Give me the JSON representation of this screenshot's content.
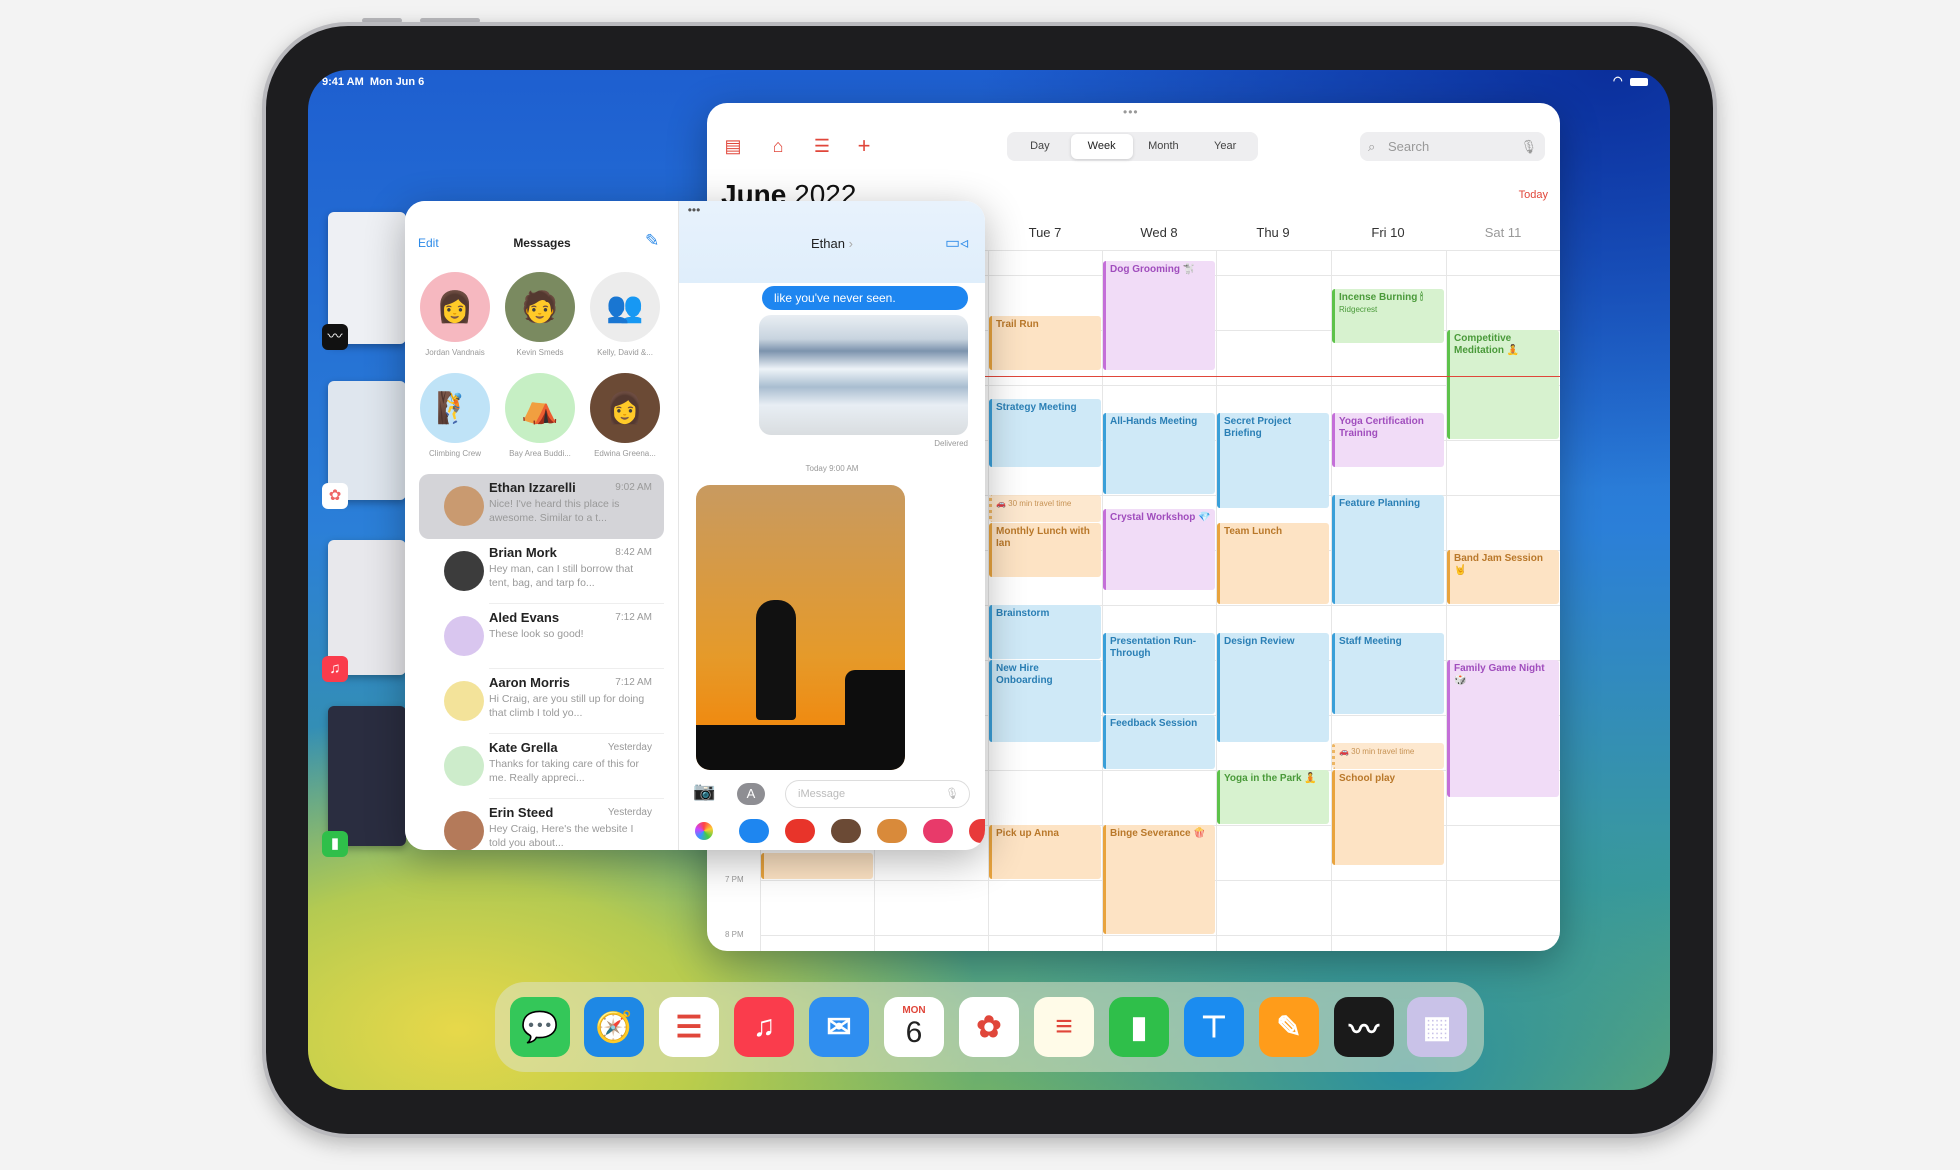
{
  "status_bar": {
    "time": "9:41 AM",
    "date": "Mon Jun 6"
  },
  "calendar": {
    "toolbar_icons": [
      "calendar-icon",
      "inbox-icon",
      "list-icon",
      "plus-icon"
    ],
    "views": [
      "Day",
      "Week",
      "Month",
      "Year"
    ],
    "selected_view": "Week",
    "search_placeholder": "Search",
    "month": "June",
    "year": "2022",
    "today_label": "Today",
    "days": [
      {
        "label": "Tue 7"
      },
      {
        "label": "Wed 8"
      },
      {
        "label": "Thu 9"
      },
      {
        "label": "Fri 10"
      },
      {
        "label": "Sat 11"
      }
    ],
    "time_labels": [
      {
        "label": "7 PM"
      },
      {
        "label": "8 PM"
      }
    ],
    "colors": {
      "blue": "#3a9fd8",
      "purple": "#c46fd8",
      "orange": "#e8a33d",
      "green": "#5dc24a",
      "now_line": "#e0463a"
    },
    "events": [
      {
        "day": "Sun 5",
        "title": "",
        "start": "18:30",
        "end": "19:00",
        "color": "orange"
      },
      {
        "day": "Tue 7",
        "title": "Trail Run",
        "start": "8:45",
        "end": "9:45",
        "color": "orange"
      },
      {
        "day": "Tue 7",
        "title": "Strategy Meeting",
        "start": "10:15",
        "end": "11:30",
        "color": "blue"
      },
      {
        "day": "Tue 7",
        "title": "🚗 30 min travel time",
        "start": "12:00",
        "end": "12:30",
        "color": "orange",
        "travel": true
      },
      {
        "day": "Tue 7",
        "title": "Monthly Lunch with Ian",
        "start": "12:30",
        "end": "13:30",
        "color": "orange"
      },
      {
        "day": "Tue 7",
        "title": "Brainstorm",
        "start": "14:00",
        "end": "15:00",
        "color": "blue"
      },
      {
        "day": "Tue 7",
        "title": "New Hire Onboarding",
        "start": "15:00",
        "end": "16:30",
        "color": "blue"
      },
      {
        "day": "Tue 7",
        "title": "Pick up Anna",
        "start": "18:00",
        "end": "19:00",
        "color": "orange"
      },
      {
        "day": "Wed 8",
        "title": "Dog Grooming 🐩",
        "start": "7:45",
        "end": "9:45",
        "color": "purple"
      },
      {
        "day": "Wed 8",
        "title": "All-Hands Meeting",
        "start": "10:30",
        "end": "12:00",
        "color": "blue"
      },
      {
        "day": "Wed 8",
        "title": "Crystal Workshop 💎",
        "start": "12:15",
        "end": "13:45",
        "color": "purple"
      },
      {
        "day": "Wed 8",
        "title": "Presentation Run-Through",
        "start": "14:30",
        "end": "16:00",
        "color": "blue"
      },
      {
        "day": "Wed 8",
        "title": "Feedback Session",
        "start": "16:00",
        "end": "17:00",
        "color": "blue"
      },
      {
        "day": "Wed 8",
        "title": "Binge Severance 🍿",
        "start": "18:00",
        "end": "20:00",
        "color": "orange"
      },
      {
        "day": "Thu 9",
        "title": "Secret Project Briefing",
        "start": "10:30",
        "end": "12:15",
        "color": "blue"
      },
      {
        "day": "Thu 9",
        "title": "Team Lunch",
        "start": "12:30",
        "end": "14:00",
        "color": "orange"
      },
      {
        "day": "Thu 9",
        "title": "Design Review",
        "start": "14:30",
        "end": "16:30",
        "color": "blue"
      },
      {
        "day": "Thu 9",
        "title": "Yoga in the Park 🧘",
        "start": "17:00",
        "end": "18:00",
        "color": "green"
      },
      {
        "day": "Fri 10",
        "title": "Incense Burning 🕯",
        "location": "Ridgecrest",
        "start": "8:15",
        "end": "9:15",
        "color": "green"
      },
      {
        "day": "Fri 10",
        "title": "Yoga Certification Training",
        "start": "10:30",
        "end": "11:30",
        "color": "purple"
      },
      {
        "day": "Fri 10",
        "title": "Feature Planning",
        "start": "12:00",
        "end": "14:00",
        "color": "blue"
      },
      {
        "day": "Fri 10",
        "title": "Staff Meeting",
        "start": "14:30",
        "end": "16:00",
        "color": "blue"
      },
      {
        "day": "Fri 10",
        "title": "🚗 30 min travel time",
        "start": "16:30",
        "end": "17:00",
        "color": "orange",
        "travel": true
      },
      {
        "day": "Fri 10",
        "title": "School play",
        "start": "17:00",
        "end": "18:45",
        "color": "orange"
      },
      {
        "day": "Sat 11",
        "title": "Competitive Meditation 🧘",
        "start": "9:00",
        "end": "11:00",
        "color": "green"
      },
      {
        "day": "Sat 11",
        "title": "Band Jam Session 🤘",
        "start": "13:00",
        "end": "14:00",
        "color": "orange"
      },
      {
        "day": "Sat 11",
        "title": "Family Game Night 🎲",
        "start": "15:00",
        "end": "17:30",
        "color": "purple"
      }
    ]
  },
  "messages": {
    "edit_label": "Edit",
    "title": "Messages",
    "pinned": [
      {
        "name": "Jordan Vandnais",
        "bg": "#f6b8c0",
        "glyph": "👩"
      },
      {
        "name": "Kevin Smeds",
        "bg": "#7a8a60",
        "glyph": "🧑"
      },
      {
        "name": "Kelly, David &...",
        "bg": "#ececec",
        "glyph": "👥"
      },
      {
        "name": "Climbing Crew",
        "bg": "#bfe3f7",
        "glyph": "🧗"
      },
      {
        "name": "Bay Area Buddi...",
        "bg": "#c6efc4",
        "glyph": "⛺"
      },
      {
        "name": "Edwina Greena...",
        "bg": "#6b4a35",
        "glyph": "👩"
      }
    ],
    "conversations": [
      {
        "name": "Ethan Izzarelli",
        "time": "9:02 AM",
        "preview": "Nice! I've heard this place is awesome. Similar to a t...",
        "avatar": "#c99a70"
      },
      {
        "name": "Brian Mork",
        "time": "8:42 AM",
        "preview": "Hey man, can I still borrow that tent, bag, and tarp fo...",
        "avatar": "#3c3c3c"
      },
      {
        "name": "Aled Evans",
        "time": "7:12 AM",
        "preview": "These look so good!",
        "avatar": "#d9c6ef"
      },
      {
        "name": "Aaron Morris",
        "time": "7:12 AM",
        "preview": "Hi Craig, are you still up for doing that climb I told yo...",
        "avatar": "#f3e39a"
      },
      {
        "name": "Kate Grella",
        "time": "Yesterday",
        "preview": "Thanks for taking care of this for me. Really appreci...",
        "avatar": "#cdeccb"
      },
      {
        "name": "Erin Steed",
        "time": "Yesterday",
        "preview": "Hey Craig, Here's the website I told you about...",
        "avatar": "#b47a5a"
      }
    ]
  },
  "chat": {
    "contact": "Ethan",
    "bubble_text": "like you've never seen.",
    "delivered": "Delivered",
    "timestamp": "Today 9:00 AM",
    "input_placeholder": "iMessage",
    "app_strip": [
      "photos-icon",
      "app-store-icon",
      "audio-icon",
      "memoji-icon",
      "memoji-stickers-icon",
      "search-images-icon",
      "music-icon"
    ]
  },
  "dock": {
    "apps": [
      {
        "name": "Messages",
        "icon": "messages-icon",
        "bg": "#34c759",
        "glyph": "💬"
      },
      {
        "name": "Safari",
        "icon": "safari-icon",
        "bg": "#1e88e5",
        "glyph": "🧭"
      },
      {
        "name": "Reminders",
        "icon": "reminders-icon",
        "bg": "#ffffff",
        "glyph": "☰"
      },
      {
        "name": "Music",
        "icon": "music-icon",
        "bg": "#fa3c4c",
        "glyph": "♫"
      },
      {
        "name": "Mail",
        "icon": "mail-icon",
        "bg": "#2f8ef0",
        "glyph": "✉"
      },
      {
        "name": "Calendar",
        "icon": "calendar-icon",
        "bg": "#ffffff",
        "glyph": ""
      },
      {
        "name": "Photos",
        "icon": "photos-icon",
        "bg": "#ffffff",
        "glyph": "✿"
      },
      {
        "name": "Notes",
        "icon": "notes-icon",
        "bg": "#fffbe8",
        "glyph": "≡"
      },
      {
        "name": "Numbers",
        "icon": "numbers-icon",
        "bg": "#2fbf4a",
        "glyph": "▮"
      },
      {
        "name": "Keynote",
        "icon": "keynote-icon",
        "bg": "#1b8cf0",
        "glyph": "⊤"
      },
      {
        "name": "Pages",
        "icon": "pages-icon",
        "bg": "#ff9c1a",
        "glyph": "✎"
      },
      {
        "name": "Freeform",
        "icon": "freeform-icon",
        "bg": "#1a1a1a",
        "glyph": "〰"
      },
      {
        "name": "App Library",
        "icon": "app-library-icon",
        "bg": "#c9c2e8",
        "glyph": "▦"
      }
    ],
    "calendar_icon": {
      "weekday": "MON",
      "date": "6"
    }
  },
  "stage_manager": [
    {
      "app": "Freeform",
      "icon": "freeform-icon"
    },
    {
      "app": "Photos",
      "icon": "photos-icon"
    },
    {
      "app": "Music",
      "icon": "music-icon"
    },
    {
      "app": "Numbers",
      "icon": "numbers-icon"
    }
  ]
}
